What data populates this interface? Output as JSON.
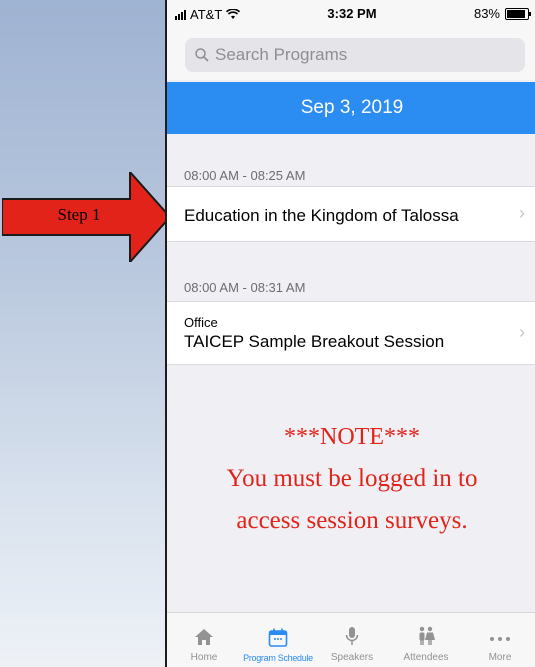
{
  "status_bar": {
    "carrier": "AT&T",
    "time": "3:32 PM",
    "battery": "83%"
  },
  "search": {
    "placeholder": "Search Programs"
  },
  "date_header": "Sep 3, 2019",
  "sessions": [
    {
      "time": "08:00 AM - 08:25 AM",
      "subtitle": "",
      "title": "Education in the Kingdom of Talossa"
    },
    {
      "time": "08:00 AM - 08:31 AM",
      "subtitle": "Office",
      "title": "TAICEP Sample Breakout Session"
    }
  ],
  "annotation": {
    "step": "Step 1",
    "colors": {
      "arrow": "#e2231a"
    }
  },
  "note": {
    "heading": "***NOTE***",
    "line1": "You must be logged in to",
    "line2": "access session surveys."
  },
  "tabbar": {
    "items": [
      {
        "label": "Home",
        "icon": "home-icon"
      },
      {
        "label": "Program Schedule",
        "icon": "calendar-icon",
        "active": true
      },
      {
        "label": "Speakers",
        "icon": "microphone-icon"
      },
      {
        "label": "Attendees",
        "icon": "people-icon"
      },
      {
        "label": "More",
        "icon": "more-icon"
      }
    ]
  },
  "colors": {
    "accent": "#2b8cf2",
    "note": "#e2231a"
  }
}
